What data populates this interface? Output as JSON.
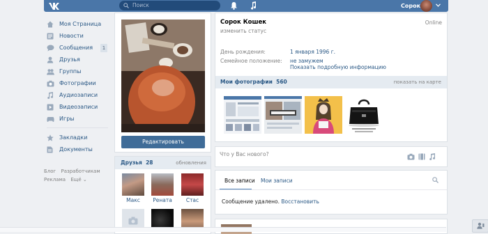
{
  "header": {
    "logo_icon": "vk-logo-icon",
    "search_placeholder": "Поиск",
    "notifications_icon": "bell-icon",
    "music_icon": "music-note-icon",
    "user_name": "Сорок",
    "accent": "#4a76a8"
  },
  "sidebar": {
    "items": [
      {
        "label": "Моя Страница",
        "icon": "home-icon"
      },
      {
        "label": "Новости",
        "icon": "news-icon"
      },
      {
        "label": "Сообщения",
        "icon": "messages-icon",
        "badge": "1"
      },
      {
        "label": "Друзья",
        "icon": "friend-icon"
      },
      {
        "label": "Группы",
        "icon": "groups-icon"
      },
      {
        "label": "Фотографии",
        "icon": "camera-icon"
      },
      {
        "label": "Аудиозаписи",
        "icon": "music-note-icon"
      },
      {
        "label": "Видеозаписи",
        "icon": "video-icon"
      },
      {
        "label": "Игры",
        "icon": "games-icon"
      },
      {
        "label": "Закладки",
        "icon": "star-icon"
      },
      {
        "label": "Документы",
        "icon": "document-icon"
      }
    ],
    "footer": [
      "Блог",
      "Разработчикам",
      "Реклама",
      "Ещё ⌄"
    ]
  },
  "profile_column": {
    "edit_button": "Редактировать",
    "friends_title": "Друзья",
    "friends_count": "28",
    "friends_link": "обновления",
    "friends": [
      {
        "name": "Макс"
      },
      {
        "name": "Рената"
      },
      {
        "name": "Стас"
      }
    ]
  },
  "info": {
    "name": "Сорок Кошек",
    "status_link": "изменить статус",
    "online": "Online",
    "birthday_label": "День рождения:",
    "birthday_value": "1 января 1996 г.",
    "relationship_label": "Семейное положение:",
    "relationship_value": "не замужем",
    "more_link": "Показать подробную информацию"
  },
  "photos": {
    "title": "Мои фотографии",
    "count": "560",
    "map_link": "показать на карте"
  },
  "composer": {
    "placeholder": "Что у Вас нового?",
    "icons": [
      "camera-icon",
      "video-icon",
      "music-note-icon"
    ]
  },
  "wall": {
    "tab_all": "Все записи",
    "tab_mine": "Мои записи",
    "deleted_text": "Сообщение удалено.",
    "restore_link": "Восстановить"
  }
}
